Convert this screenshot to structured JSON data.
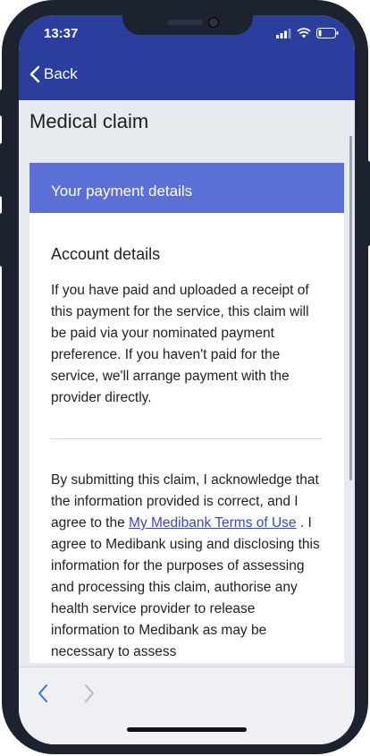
{
  "status": {
    "time": "13:37"
  },
  "nav": {
    "back_label": "Back"
  },
  "page": {
    "title": "Medical claim"
  },
  "card": {
    "header": "Your payment details",
    "section_title": "Account details",
    "paragraph1": "If you have paid and uploaded a receipt of this payment for the service, this claim will be paid via your nominated payment preference. If you haven't paid for the service, we'll arrange payment with the provider directly.",
    "paragraph2_before": "By submitting this claim, I acknowledge that the information provided is correct, and I agree to the ",
    "terms_link": "My Medibank Terms of Use",
    "paragraph2_after": " . I agree to Medibank using and disclosing this information for the purposes of assessing and processing this claim, authorise any health service provider to release information to Medibank as may be necessary to assess"
  },
  "footer": {
    "prev_icon": "chevron-left-icon",
    "next_icon": "chevron-right-icon"
  },
  "colors": {
    "header_bg": "#2b3e9e",
    "card_header_bg": "#5b6fd6",
    "link": "#3a4ab0",
    "active_arrow": "#3b73d6",
    "inactive_arrow": "#b3b7bf"
  }
}
